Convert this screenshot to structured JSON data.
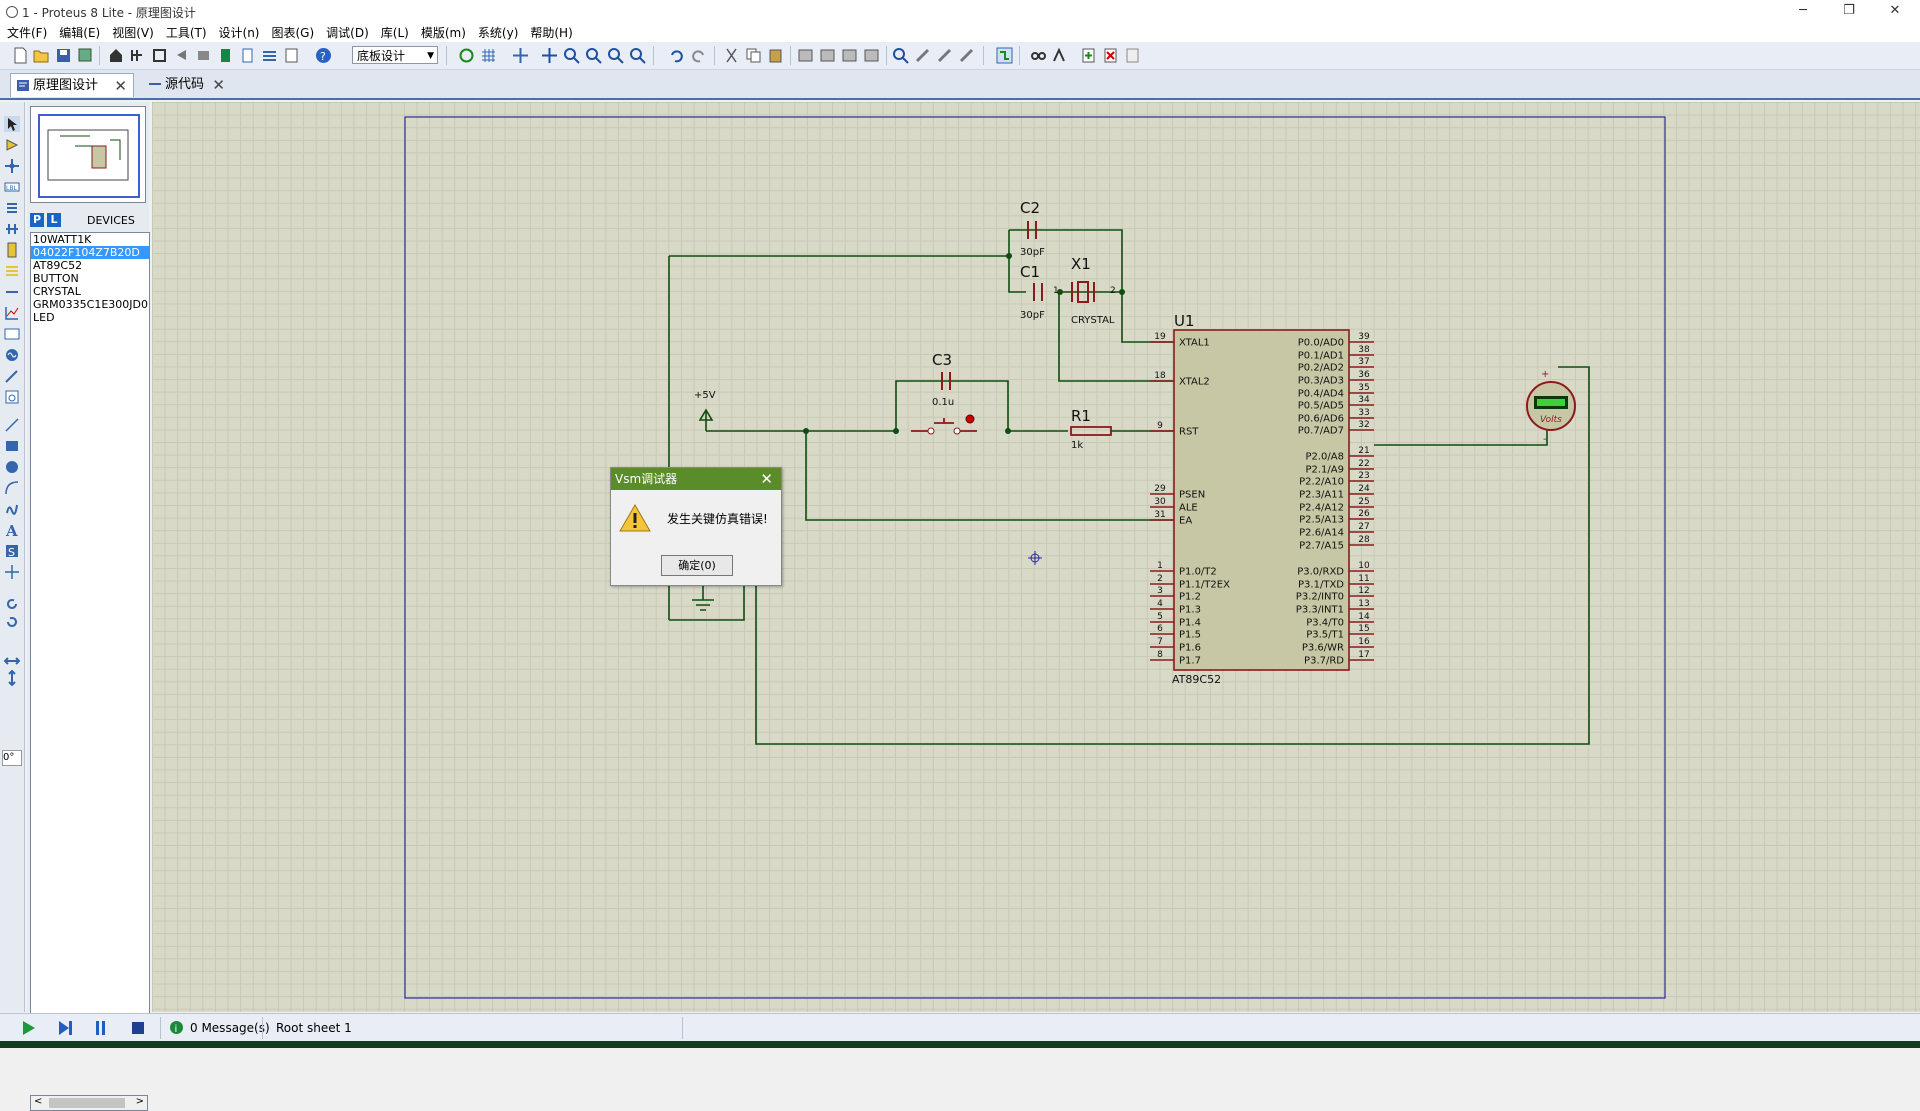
{
  "window": {
    "title": "1 - Proteus 8 Lite - 原理图设计",
    "minimize": "─",
    "restore": "❐",
    "close": "✕"
  },
  "menu": [
    "文件(F)",
    "编辑(E)",
    "视图(V)",
    "工具(T)",
    "设计(n)",
    "图表(G)",
    "调试(D)",
    "库(L)",
    "模版(m)",
    "系统(y)",
    "帮助(H)"
  ],
  "toolbar": {
    "layer_combo": "底板设计"
  },
  "tabs": [
    {
      "label": "原理图设计",
      "close": "✕"
    },
    {
      "label": "源代码",
      "close": "✕"
    }
  ],
  "left_tools": {
    "angle": "0°"
  },
  "device_panel": {
    "p_button": "P",
    "l_button": "L",
    "header": "DEVICES",
    "items": [
      "10WATT1K",
      "04022F104Z7B20D",
      "AT89C52",
      "BUTTON",
      "CRYSTAL",
      "GRM0335C1E300JD01",
      "LED"
    ],
    "selected_index": 1
  },
  "schematic": {
    "c2": {
      "ref": "C2",
      "value": "30pF"
    },
    "c1": {
      "ref": "C1",
      "value": "30pF"
    },
    "x1": {
      "ref": "X1",
      "value": "CRYSTAL",
      "pin1": "1",
      "pin2": "2"
    },
    "c3": {
      "ref": "C3",
      "value": "0.1u"
    },
    "r1": {
      "ref": "R1",
      "value": "1k"
    },
    "power": "+5V",
    "u1": {
      "ref": "U1",
      "part": "AT89C52",
      "left_pins": [
        {
          "num": "19",
          "name": "XTAL1"
        },
        {
          "num": "18",
          "name": "XTAL2"
        },
        {
          "num": "9",
          "name": "RST"
        },
        {
          "num": "29",
          "name": "PSEN"
        },
        {
          "num": "30",
          "name": "ALE"
        },
        {
          "num": "31",
          "name": "EA"
        },
        {
          "num": "1",
          "name": "P1.0/T2"
        },
        {
          "num": "2",
          "name": "P1.1/T2EX"
        },
        {
          "num": "3",
          "name": "P1.2"
        },
        {
          "num": "4",
          "name": "P1.3"
        },
        {
          "num": "5",
          "name": "P1.4"
        },
        {
          "num": "6",
          "name": "P1.5"
        },
        {
          "num": "7",
          "name": "P1.6"
        },
        {
          "num": "8",
          "name": "P1.7"
        }
      ],
      "right_pins": [
        {
          "num": "39",
          "name": "P0.0/AD0"
        },
        {
          "num": "38",
          "name": "P0.1/AD1"
        },
        {
          "num": "37",
          "name": "P0.2/AD2"
        },
        {
          "num": "36",
          "name": "P0.3/AD3"
        },
        {
          "num": "35",
          "name": "P0.4/AD4"
        },
        {
          "num": "34",
          "name": "P0.5/AD5"
        },
        {
          "num": "33",
          "name": "P0.6/AD6"
        },
        {
          "num": "32",
          "name": "P0.7/AD7"
        },
        {
          "num": "21",
          "name": "P2.0/A8"
        },
        {
          "num": "22",
          "name": "P2.1/A9"
        },
        {
          "num": "23",
          "name": "P2.2/A10"
        },
        {
          "num": "24",
          "name": "P2.3/A11"
        },
        {
          "num": "25",
          "name": "P2.4/A12"
        },
        {
          "num": "26",
          "name": "P2.5/A13"
        },
        {
          "num": "27",
          "name": "P2.6/A14"
        },
        {
          "num": "28",
          "name": "P2.7/A15"
        },
        {
          "num": "10",
          "name": "P3.0/RXD"
        },
        {
          "num": "11",
          "name": "P3.1/TXD"
        },
        {
          "num": "12",
          "name": "P3.2/INT0"
        },
        {
          "num": "13",
          "name": "P3.3/INT1"
        },
        {
          "num": "14",
          "name": "P3.4/T0"
        },
        {
          "num": "15",
          "name": "P3.5/T1"
        },
        {
          "num": "16",
          "name": "P3.6/WR"
        },
        {
          "num": "17",
          "name": "P3.7/RD"
        }
      ]
    },
    "voltmeter": {
      "label": "Volts",
      "plus": "+",
      "minus": "-"
    }
  },
  "dialog": {
    "title": "Vsm调试器",
    "close": "✕",
    "message": "发生关键仿真错误!",
    "ok": "确定(0)"
  },
  "status": {
    "messages": "0 Message(s)",
    "sheet": "Root sheet 1"
  },
  "colors": {
    "wire": "#0f4d0f",
    "component": "#8b1a1a",
    "chip_fill": "#c7c7a5",
    "sheet_border": "#2b2b9b",
    "dialog_header": "#5b8c2a"
  }
}
